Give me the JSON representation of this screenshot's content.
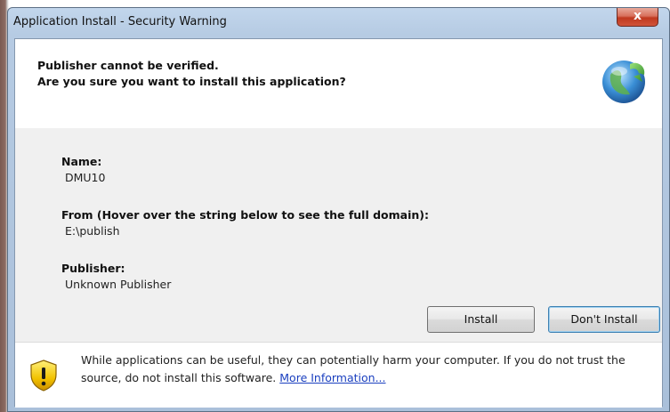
{
  "window": {
    "title": "Application Install - Security Warning",
    "close_label": "x"
  },
  "header": {
    "line1": "Publisher cannot be verified.",
    "line2": "Are you sure you want to install this application?",
    "icon": "clickonce-globe-icon"
  },
  "details": {
    "name_label": "Name:",
    "name_value": "DMU10",
    "from_label": "From (Hover over the string below to see the full domain):",
    "from_value": "E:\\publish",
    "publisher_label": "Publisher:",
    "publisher_value": "Unknown Publisher"
  },
  "buttons": {
    "install": "Install",
    "dont_install": "Don't Install"
  },
  "footer": {
    "icon": "shield-warning-icon",
    "text": "While applications can be useful, they can potentially harm your computer. If you do not trust the source, do not install this software.",
    "link": "More Information..."
  },
  "colors": {
    "title_bar": "#b6cbe3",
    "close_button": "#c0391f",
    "link": "#1a3fbf",
    "shield": "#f2c200"
  }
}
